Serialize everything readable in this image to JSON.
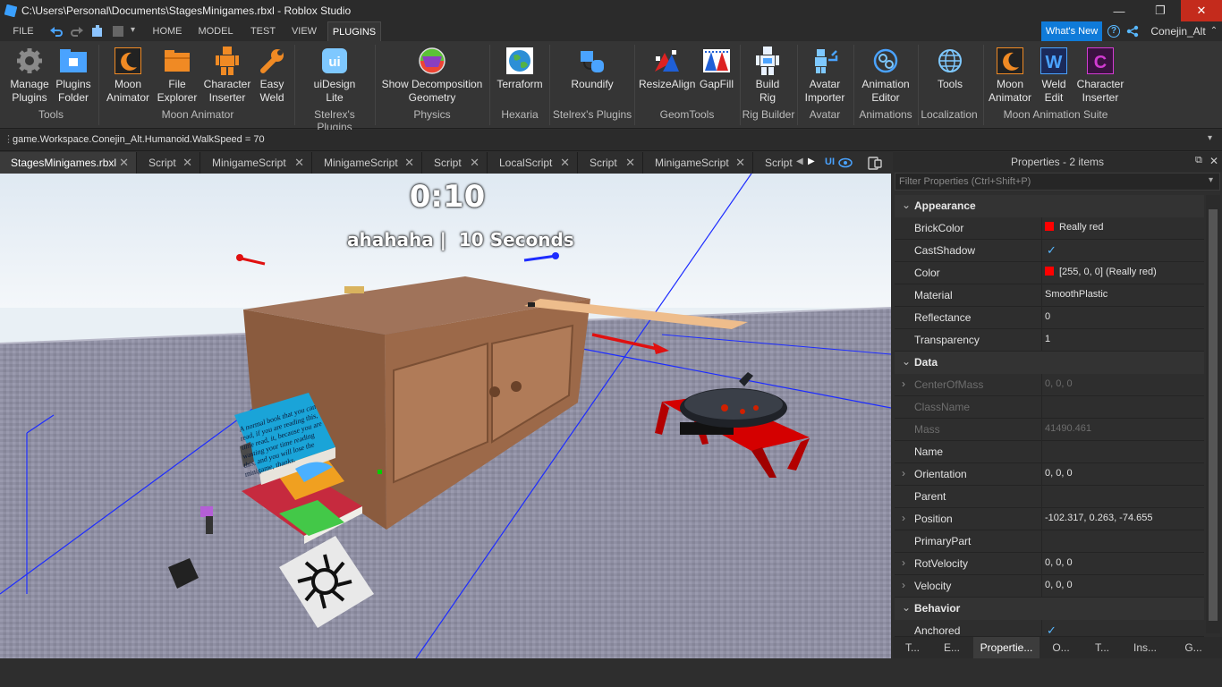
{
  "window": {
    "title": "C:\\Users\\Personal\\Documents\\StagesMinigames.rbxl - Roblox Studio",
    "min": "—",
    "max": "❐",
    "close": "✕"
  },
  "menubar": {
    "file": "FILE",
    "tabs": [
      "HOME",
      "MODEL",
      "TEST",
      "VIEW",
      "PLUGINS"
    ],
    "active": "PLUGINS",
    "whats_new": "What's New",
    "help": "?",
    "user": "Conejin_Alt",
    "caret": "⌃"
  },
  "ribbon": {
    "buttons": [
      {
        "label1": "Manage",
        "label2": "Plugins",
        "icon": "gear-icon"
      },
      {
        "label1": "Plugins",
        "label2": "Folder",
        "icon": "folder-plugin-icon"
      },
      {
        "label1": "Moon",
        "label2": "Animator",
        "icon": "moon-icon"
      },
      {
        "label1": "File",
        "label2": "Explorer",
        "icon": "folder-icon"
      },
      {
        "label1": "Character",
        "label2": "Inserter",
        "icon": "character-icon"
      },
      {
        "label1": "Easy",
        "label2": "Weld",
        "icon": "wrench-icon"
      },
      {
        "label1": "uiDesign",
        "label2": "Lite",
        "icon": "uidesign-icon"
      },
      {
        "label1": "Show Decomposition",
        "label2": "Geometry",
        "icon": "decomposition-icon"
      },
      {
        "label1": "Terraform",
        "label2": "",
        "icon": "globe-icon"
      },
      {
        "label1": "Roundify",
        "label2": "",
        "icon": "roundify-icon"
      },
      {
        "label1": "ResizeAlign",
        "label2": "",
        "icon": "resize-icon"
      },
      {
        "label1": "GapFill",
        "label2": "",
        "icon": "gapfill-icon"
      },
      {
        "label1": "Build",
        "label2": "Rig",
        "icon": "rig-icon"
      },
      {
        "label1": "Avatar",
        "label2": "Importer",
        "icon": "avatar-import-icon"
      },
      {
        "label1": "Animation",
        "label2": "Editor",
        "icon": "animation-icon"
      },
      {
        "label1": "Tools",
        "label2": "",
        "icon": "localization-globe-icon"
      },
      {
        "label1": "Moon",
        "label2": "Animator",
        "icon": "moon-icon"
      },
      {
        "label1": "Weld",
        "label2": "Edit",
        "icon": "weld-w-icon"
      },
      {
        "label1": "Character",
        "label2": "Inserter",
        "icon": "character-c-icon"
      }
    ],
    "groups": [
      "Tools",
      "Moon Animator",
      "Stelrex's Plugins",
      "Physics",
      "Hexaria",
      "Stelrex's Plugins",
      "GeomTools",
      "Rig Builder",
      "Avatar",
      "Animations",
      "Localization",
      "Moon Animation Suite"
    ]
  },
  "command": {
    "text": "game.Workspace.Conejin_Alt.Humanoid.WalkSpeed = 70"
  },
  "tabs": [
    "StagesMinigames.rbxl",
    "Script",
    "MinigameScript",
    "MinigameScript",
    "Script",
    "LocalScript",
    "Script",
    "MinigameScript",
    "Script"
  ],
  "tab_extra": {
    "ui": "UI"
  },
  "viewport": {
    "timer": "0:10",
    "message": "ahahaha |  10 Seconds",
    "book_text": "A normal book that you can read, if you are reading this, time read, it, because you are wasting your time reading this, and you will lose the minigame, thanks."
  },
  "properties": {
    "title": "Properties - 2 items",
    "filter_placeholder": "Filter Properties (Ctrl+Shift+P)",
    "sections": {
      "appearance": "Appearance",
      "data": "Data",
      "behavior": "Behavior"
    },
    "rows": [
      {
        "name": "BrickColor",
        "value": "Really red"
      },
      {
        "name": "CastShadow",
        "value": "✓"
      },
      {
        "name": "Color",
        "value": "[255, 0, 0] (Really red)"
      },
      {
        "name": "Material",
        "value": "SmoothPlastic"
      },
      {
        "name": "Reflectance",
        "value": "0"
      },
      {
        "name": "Transparency",
        "value": "1"
      },
      {
        "name": "CenterOfMass",
        "value": "0, 0, 0"
      },
      {
        "name": "ClassName",
        "value": ""
      },
      {
        "name": "Mass",
        "value": "41490.461"
      },
      {
        "name": "Name",
        "value": ""
      },
      {
        "name": "Orientation",
        "value": "0, 0, 0"
      },
      {
        "name": "Parent",
        "value": ""
      },
      {
        "name": "Position",
        "value": "-102.317, 0.263, -74.655"
      },
      {
        "name": "PrimaryPart",
        "value": ""
      },
      {
        "name": "RotVelocity",
        "value": "0, 0, 0"
      },
      {
        "name": "Velocity",
        "value": "0, 0, 0"
      },
      {
        "name": "Anchored",
        "value": "✓"
      }
    ],
    "swatch_color": "#ff0000"
  },
  "bottom_tabs": [
    "T...",
    "E...",
    "Propertie...",
    "O...",
    "T...",
    "Ins...",
    "G..."
  ]
}
